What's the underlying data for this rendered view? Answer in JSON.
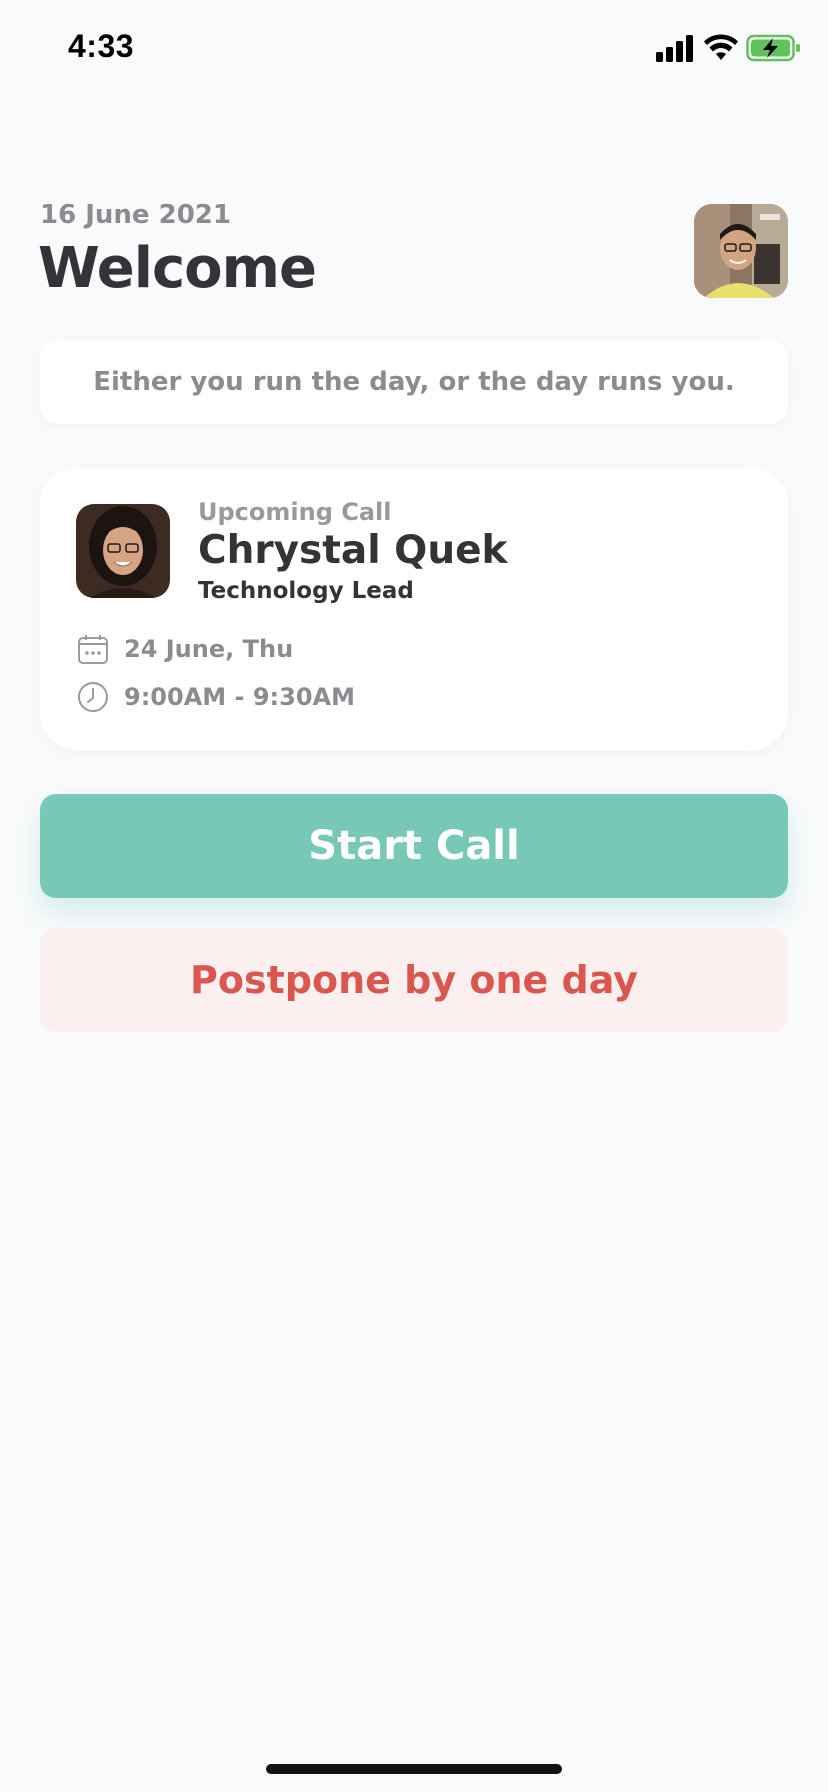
{
  "status_bar": {
    "time": "4:33",
    "icons": [
      "cellular-signal-icon",
      "wifi-icon",
      "battery-charging-icon"
    ],
    "battery_color": "#5fc25a"
  },
  "header": {
    "date": "16 June 2021",
    "title": "Welcome"
  },
  "quote": {
    "text": "Either you run the day, or the day runs you."
  },
  "upcoming_call": {
    "label": "Upcoming Call",
    "name": "Chrystal Quek",
    "role": "Technology Lead",
    "date": "24 June, Thu",
    "time": "9:00AM - 9:30AM"
  },
  "actions": {
    "start_call": "Start Call",
    "postpone": "Postpone by one day"
  },
  "colors": {
    "background": "#f9fafc",
    "primary_teal": "#77c8b6",
    "danger_red": "#d9574f",
    "danger_bg": "#fcefef",
    "text_dark": "#333437",
    "text_muted": "#8c8c90"
  }
}
